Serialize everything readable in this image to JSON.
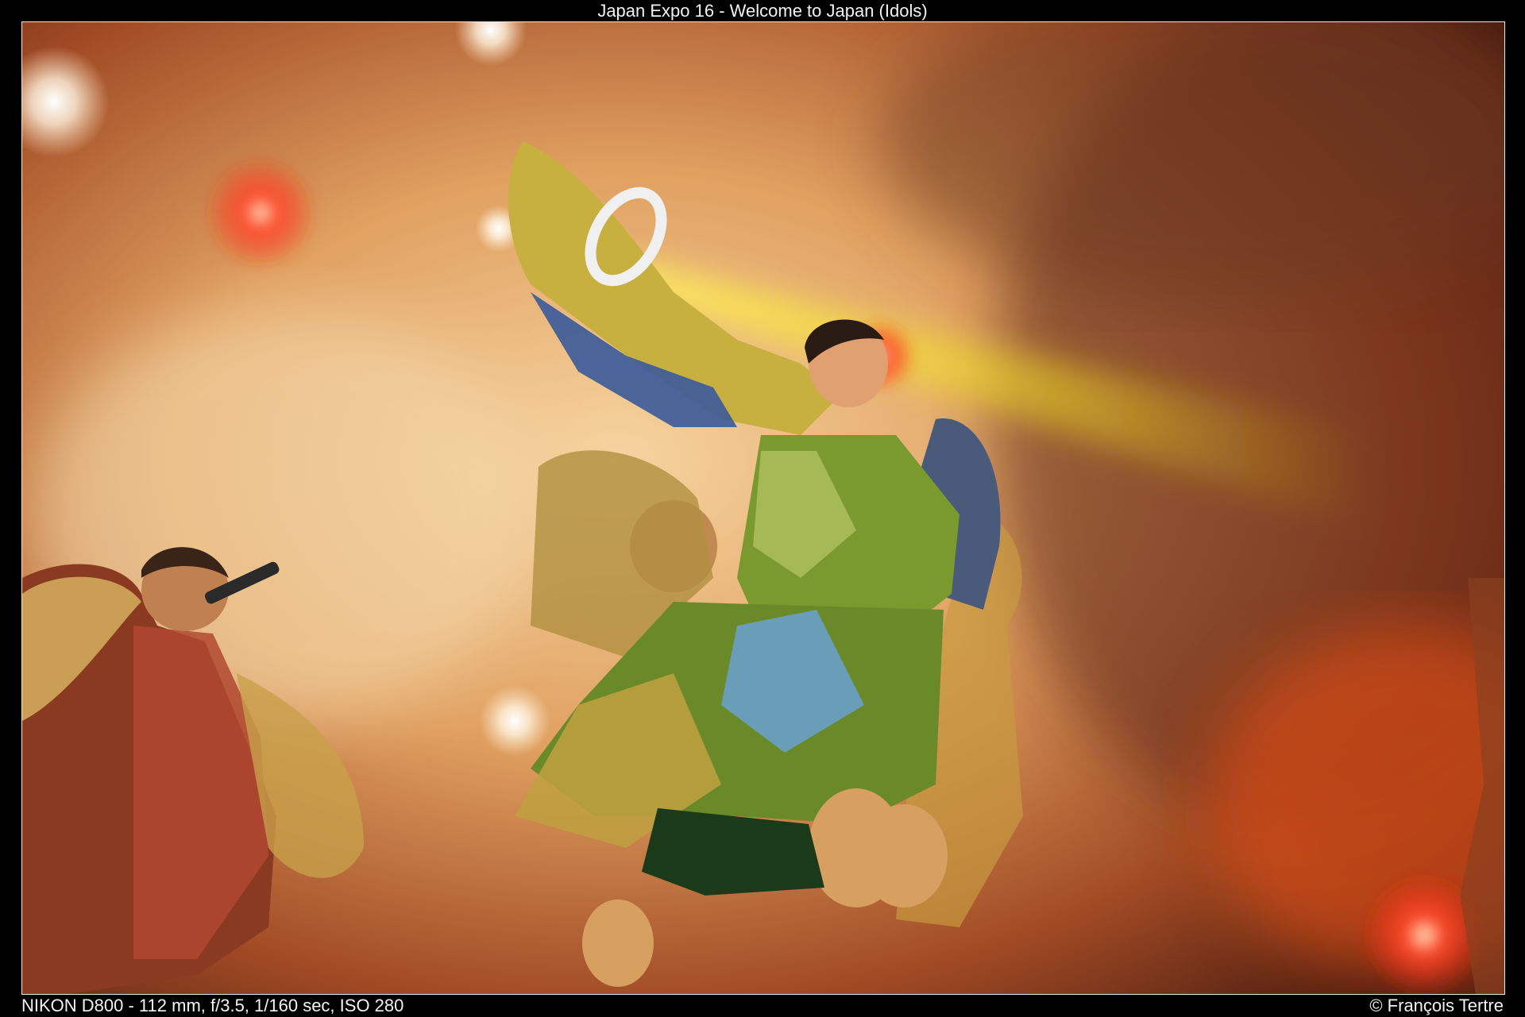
{
  "viewer": {
    "title": "Japan Expo 16 - Welcome to Japan (Idols)",
    "exif": "NIKON D800 - 112 mm, f/3.5, 1/160 sec, ISO 280",
    "credit": "© François Tertre"
  },
  "photo": {
    "colors": {
      "haze_warm": "#e8b070",
      "haze_dark": "#5a2414",
      "beam_yellow": "#f4e020",
      "red_light": "#ff3a20",
      "costume_green": "#4a7a20",
      "costume_blue": "#3a5a9a",
      "skin": "#e0a070"
    }
  }
}
